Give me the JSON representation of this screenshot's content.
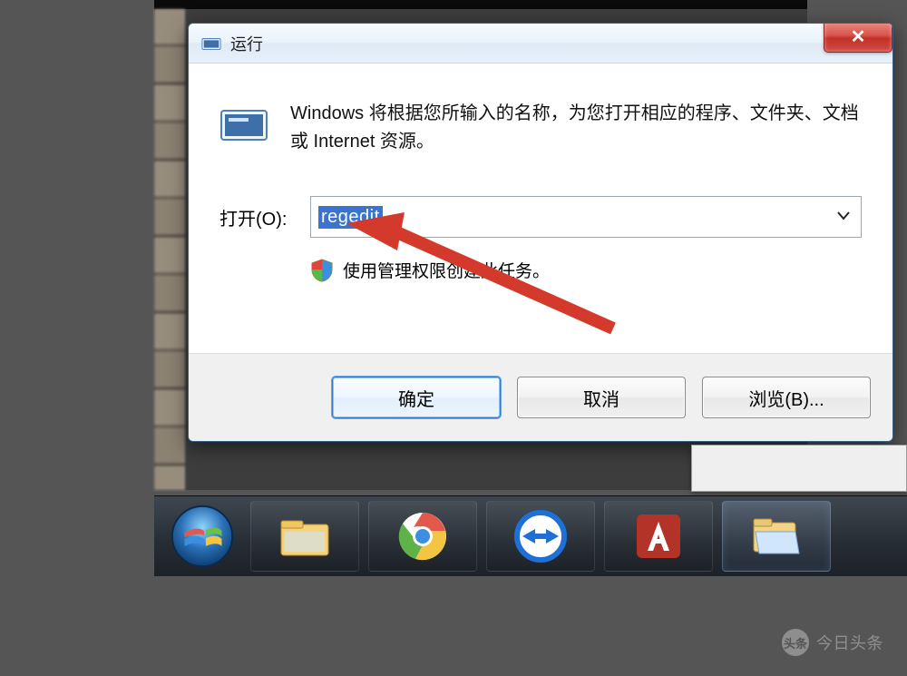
{
  "dialog": {
    "title": "运行",
    "description": "Windows 将根据您所输入的名称，为您打开相应的程序、文件夹、文档或 Internet 资源。",
    "open_label": "打开(O):",
    "open_value": "regedit",
    "admin_note": "使用管理权限创建此任务。",
    "buttons": {
      "ok": "确定",
      "cancel": "取消",
      "browse": "浏览(B)..."
    },
    "close_glyph": "✕"
  },
  "taskbar": {
    "items": [
      {
        "name": "file-explorer",
        "active": false
      },
      {
        "name": "chrome",
        "active": false
      },
      {
        "name": "teamviewer",
        "active": false
      },
      {
        "name": "autocad",
        "active": false
      },
      {
        "name": "folder-open",
        "active": true
      }
    ]
  },
  "watermark": {
    "glyph": "头条",
    "text": "今日头条"
  },
  "colors": {
    "close_red": "#c9372f",
    "accent_blue": "#3a74d0",
    "arrow_red": "#d43a2b"
  }
}
